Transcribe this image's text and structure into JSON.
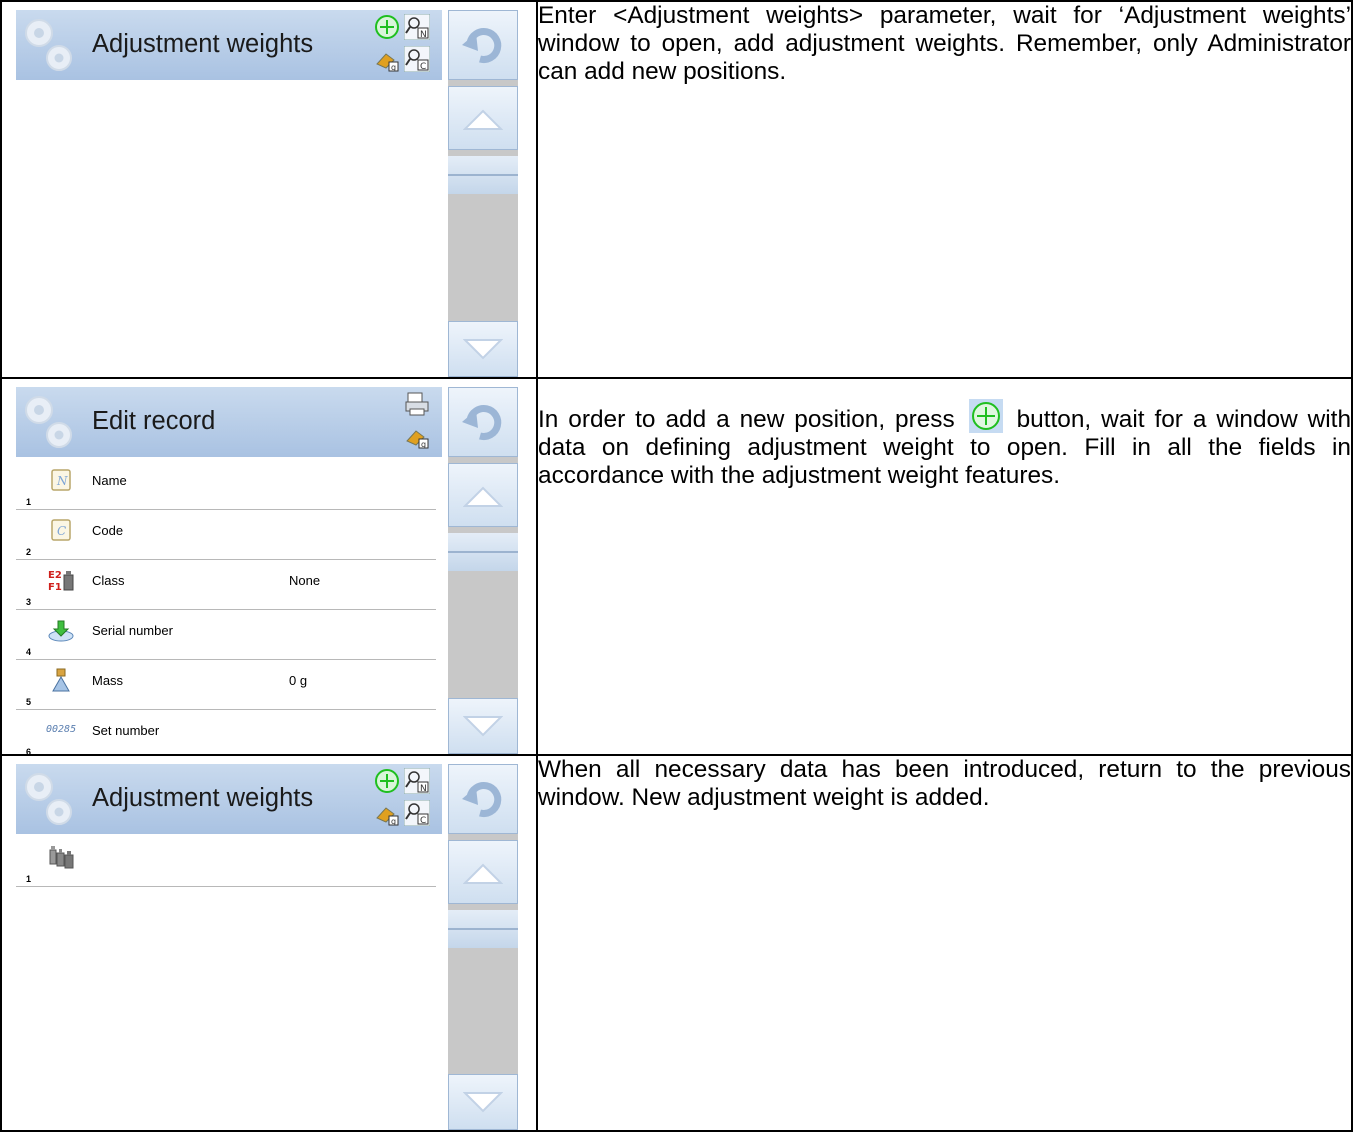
{
  "rows": [
    {
      "screen": {
        "title": "Adjustment weights"
      },
      "description": "Enter <Adjustment weights> parameter, wait for ‘Adjustment weights’ window to open, add adjustment weights. Remember, only Administrator can add new positions."
    },
    {
      "screen": {
        "title": "Edit record",
        "records": [
          {
            "num": "1",
            "label": "Name",
            "value": "",
            "icon": "name-icon"
          },
          {
            "num": "2",
            "label": "Code",
            "value": "",
            "icon": "code-icon"
          },
          {
            "num": "3",
            "label": "Class",
            "value": "None",
            "icon": "class-icon",
            "icon_text": "E2\nF1"
          },
          {
            "num": "4",
            "label": "Serial number",
            "value": "",
            "icon": "serial-number-icon"
          },
          {
            "num": "5",
            "label": "Mass",
            "value": "0 g",
            "icon": "mass-icon"
          },
          {
            "num": "6",
            "label": "Set number",
            "value": "",
            "icon": "set-number-icon",
            "icon_text": "00285"
          }
        ]
      },
      "description_before": "In order to add a new position, press",
      "description_after": "button, wait for a window with data on defining adjustment weight to open. Fill in all the fields in accordance with the adjustment weight features."
    },
    {
      "screen": {
        "title": "Adjustment weights",
        "records": [
          {
            "num": "1",
            "label": "",
            "icon": "weights-icon"
          }
        ]
      },
      "description": "When all necessary data has been introduced, return to the previous window. New adjustment weight is added."
    }
  ],
  "colors": {
    "title_bar": "#b8cde8",
    "add_icon": "#1fbf1f",
    "scrollbar": "#c8c8c8"
  }
}
